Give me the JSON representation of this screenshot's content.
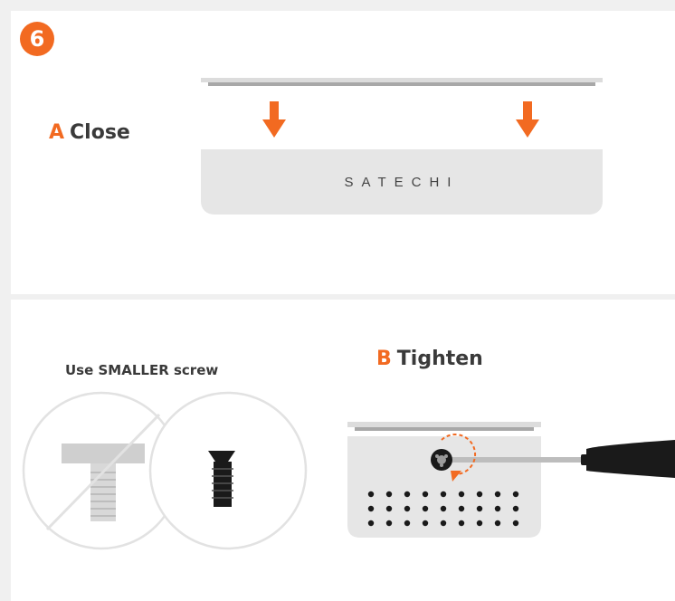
{
  "step": {
    "number": "6"
  },
  "section_a": {
    "letter": "A",
    "title": "Close",
    "brand": "SATECHI",
    "icons": [
      "lid",
      "down-arrow-icon",
      "down-arrow-icon",
      "enclosure"
    ]
  },
  "section_b": {
    "caption": "Use SMALLER screw",
    "letter": "B",
    "title": "Tighten",
    "icons": [
      "large-screw-crossed-icon",
      "small-screw-icon",
      "screwdriver-icon",
      "clockwise-arrow-icon",
      "enclosure-vents"
    ]
  },
  "colors": {
    "accent": "#f26a21",
    "panel": "#ffffff",
    "background": "#f0f0f0",
    "device": "#e6e6e6",
    "text": "#3a3a3a"
  }
}
